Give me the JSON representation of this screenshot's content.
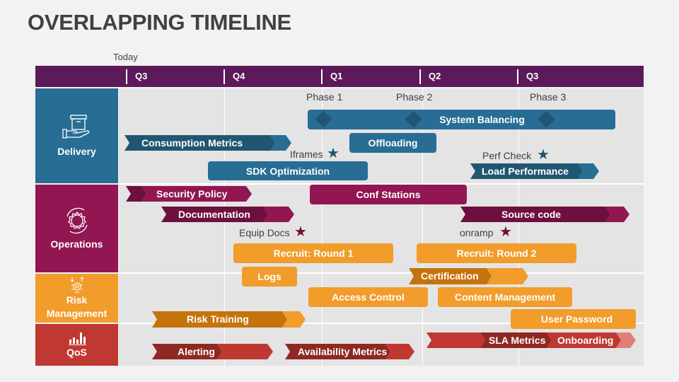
{
  "title": "OVERLAPPING TIMELINE",
  "today_label": "Today",
  "colors": {
    "header": "#5c1a5a",
    "delivery": "#276d94",
    "delivery_dark": "#215672",
    "operations": "#921652",
    "operations_dark": "#6d0f3f",
    "risk": "#f19c2b",
    "risk_dark": "#c5730d",
    "qos": "#bf3832",
    "qos_dark": "#8f2823",
    "qos_light": "#e07f7a"
  },
  "quarters": [
    "Q3",
    "Q4",
    "Q1",
    "Q2",
    "Q3"
  ],
  "phases": [
    "Phase 1",
    "Phase 2",
    "Phase 3"
  ],
  "categories": [
    {
      "name": "Delivery",
      "icon": "hand-box-icon"
    },
    {
      "name": "Operations",
      "icon": "gear-cycle-icon"
    },
    {
      "name": "Risk Management",
      "icon": "risk-gear-icon"
    },
    {
      "name": "QoS",
      "icon": "bar-chart-icon"
    }
  ],
  "delivery": {
    "system_balancing": "System Balancing",
    "consumption_metrics": "Consumption Metrics",
    "offloading": "Offloading",
    "iframes": "Iframes",
    "sdk_optimization": "SDK Optimization",
    "perf_check": "Perf Check",
    "load_performance": "Load Performance"
  },
  "operations": {
    "security_policy": "Security Policy",
    "conf_stations": "Conf Stations",
    "documentation": "Documentation",
    "source_code": "Source code",
    "equip_docs": "Equip Docs",
    "onramp": "onramp",
    "recruit_1": "Recruit: Round 1",
    "recruit_2": "Recruit: Round 2"
  },
  "risk": {
    "logs": "Logs",
    "certification": "Certification",
    "access_control": "Access Control",
    "content_management": "Content Management",
    "risk_training": "Risk Training",
    "user_password": "User Password"
  },
  "qos": {
    "alerting": "Alerting",
    "availability_metrics": "Availability Metrics",
    "sla_metrics": "SLA Metrics",
    "onboarding": "Onboarding"
  }
}
